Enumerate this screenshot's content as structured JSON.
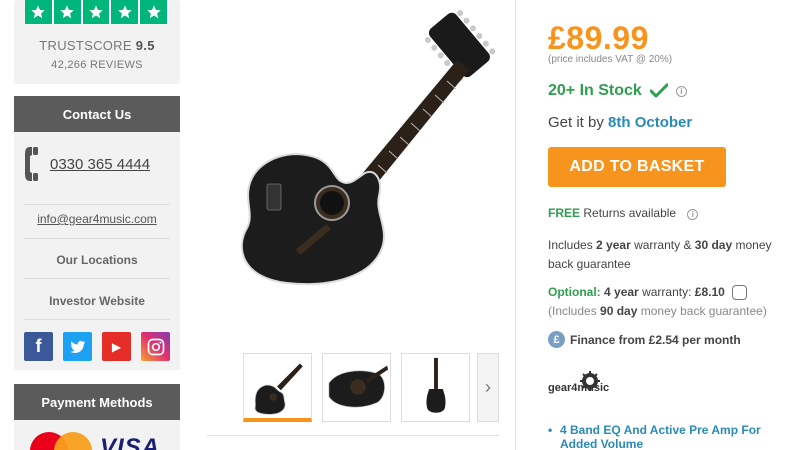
{
  "sidebar": {
    "trustpilot": {
      "score_label": "TRUSTSCORE",
      "score_value": "9.5",
      "reviews": "42,266 REVIEWS",
      "star_color": "#00b67a"
    },
    "contact": {
      "heading": "Contact Us",
      "phone": "0330 365 4444",
      "email": "info@gear4music.com",
      "locations": "Our Locations",
      "investor": "Investor Website",
      "social": [
        "facebook-icon",
        "twitter-icon",
        "youtube-icon",
        "instagram-icon"
      ],
      "social_glyphs": {
        "facebook": "f",
        "youtube": "▶"
      }
    },
    "payment": {
      "heading": "Payment Methods",
      "visa": "VISA"
    }
  },
  "product": {
    "price": "£89.99",
    "vat_note": "(price includes VAT @ 20%)",
    "stock": "20+ In Stock",
    "delivery_prefix": "Get it by",
    "delivery_date": "8th October",
    "add_to_basket": "ADD TO BASKET",
    "returns_free": "FREE",
    "returns_text": "Returns available",
    "warranty_pre": "Includes",
    "warranty_years": "2 year",
    "warranty_mid": "warranty &",
    "warranty_days": "30 day",
    "warranty_post": "money back guarantee",
    "optional_label": "Optional:",
    "optional_years": "4 year",
    "optional_mid": "warranty:",
    "optional_price": "£8.10",
    "optional_note_pre": "(Includes",
    "optional_note_days": "90 day",
    "optional_note_post": "money back guarantee)",
    "finance": "Finance from £2.54 per month",
    "finance_icon": "£",
    "info_glyph": "i",
    "brand_logo_text": "gear4music",
    "feature_1": "4 Band EQ And Active Pre Amp For Added Volume",
    "accent_color": "#f7941d",
    "stock_color": "#2f9e4e",
    "link_color": "#2a8ab8"
  },
  "gallery": {
    "thumbnails": [
      "front-view",
      "body-detail",
      "side-view"
    ],
    "active_index": 0,
    "next_glyph": "›"
  }
}
